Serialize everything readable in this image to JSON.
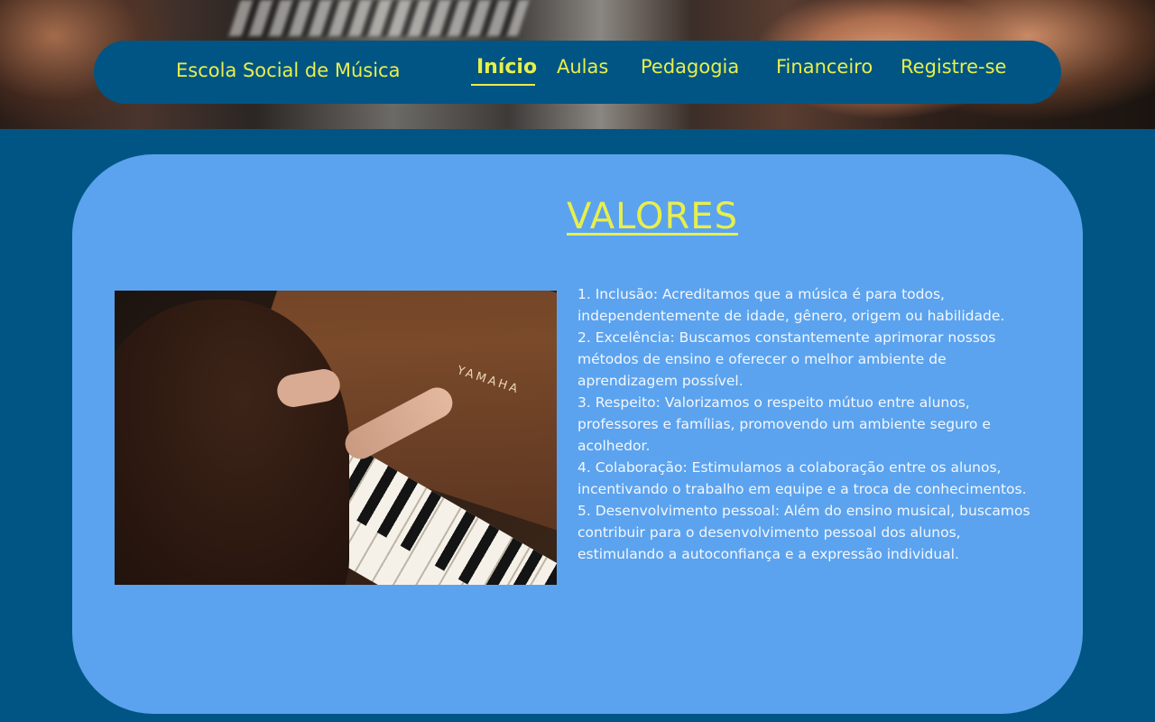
{
  "brand": "Escola Social de Música",
  "nav": {
    "items": [
      {
        "label": "Início",
        "active": true
      },
      {
        "label": "Aulas",
        "active": false
      },
      {
        "label": "Pedagogia",
        "active": false
      },
      {
        "label": "Financeiro",
        "active": false
      },
      {
        "label": "Registre-se",
        "active": false
      }
    ]
  },
  "values_section": {
    "title": "VALORES",
    "photo_label": "YAMAHA",
    "items": [
      "1. Inclusão: Acreditamos que a música é para todos, independentemente de idade, gênero, origem ou habilidade.",
      "2. Excelência: Buscamos constantemente aprimorar nossos métodos de ensino e oferecer o melhor ambiente de aprendizagem possível.",
      "3. Respeito: Valorizamos o respeito mútuo entre alunos, professores e famílias, promovendo um ambiente seguro e acolhedor.",
      "4. Colaboração: Estimulamos a colaboração entre os alunos, incentivando o trabalho em equipe e a troca de conhecimentos.",
      "5. Desenvolvimento pessoal: Além do ensino musical, buscamos contribuir para o desenvolvimento pessoal dos alunos, estimulando a autoconfiança e a expressão individual."
    ]
  },
  "colors": {
    "page_background": "#005584",
    "nav_background": "#005584",
    "accent_yellow": "#e8ef4c",
    "card_background": "#5ba3ee",
    "body_text": "#f4f7ff"
  }
}
